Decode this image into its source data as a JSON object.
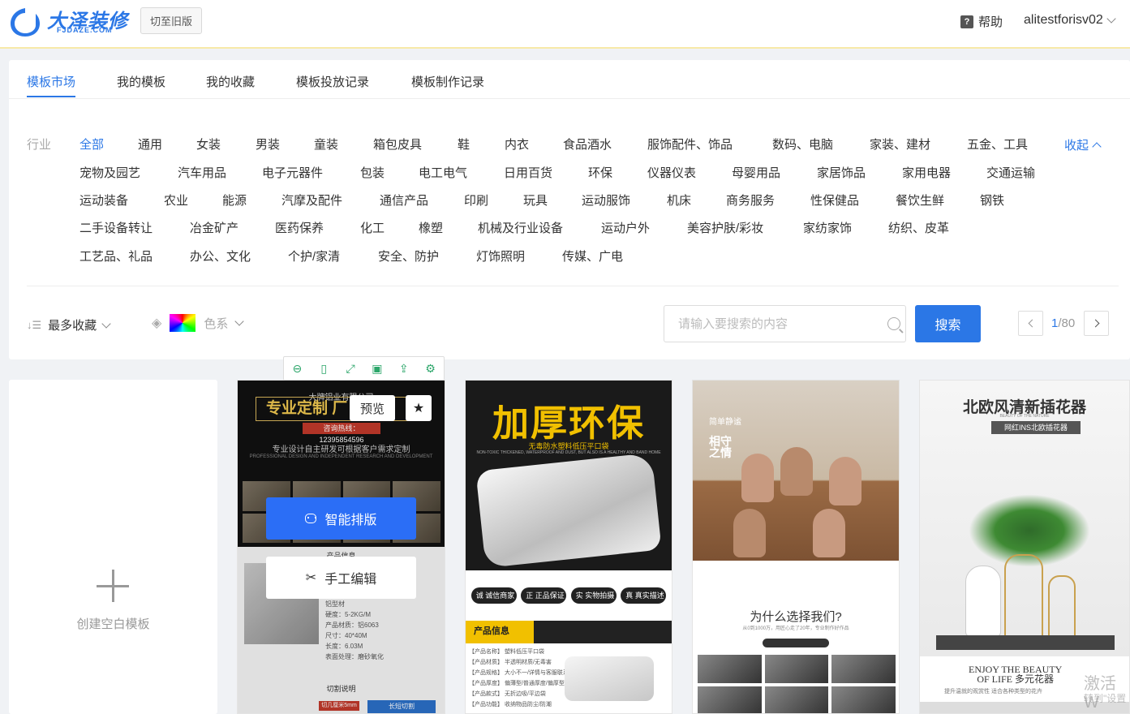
{
  "header": {
    "logo_text": "大泽装修",
    "logo_sub": "FJDAZE.COM",
    "old_version_label": "切至旧版",
    "help_label": "帮助",
    "username": "alitestforisv02"
  },
  "tabs": [
    "模板市场",
    "我的模板",
    "我的收藏",
    "模板投放记录",
    "模板制作记录"
  ],
  "filters": {
    "industry_label": "行业",
    "collapse_label": "收起",
    "categories": [
      "全部",
      "通用",
      "女装",
      "男装",
      "童装",
      "箱包皮具",
      "鞋",
      "内衣",
      "食品酒水",
      "服饰配件、饰品",
      "数码、电脑",
      "家装、建材",
      "五金、工具",
      "宠物及园艺",
      "汽车用品",
      "电子元器件",
      "包装",
      "电工电气",
      "日用百货",
      "环保",
      "仪器仪表",
      "母婴用品",
      "家居饰品",
      "家用电器",
      "交通运输",
      "运动装备",
      "农业",
      "能源",
      "汽摩及配件",
      "通信产品",
      "印刷",
      "玩具",
      "运动服饰",
      "机床",
      "商务服务",
      "性保健品",
      "餐饮生鲜",
      "钢铁",
      "二手设备转让",
      "冶金矿产",
      "医药保养",
      "化工",
      "橡塑",
      "机械及行业设备",
      "运动户外",
      "美容护肤/彩妆",
      "家纺家饰",
      "纺织、皮革",
      "工艺品、礼品",
      "办公、文化",
      "个护/家清",
      "安全、防护",
      "灯饰照明",
      "传媒、广电"
    ]
  },
  "toolbar": {
    "sort_label": "最多收藏",
    "color_label": "色系",
    "search_placeholder": "请输入要搜索的内容",
    "search_button": "搜索",
    "page_current": "1",
    "page_total": "/80"
  },
  "blank_card": {
    "label": "创建空白模板"
  },
  "hover": {
    "preview": "预览",
    "smart_layout": "智能排版",
    "manual_edit": "手工编辑"
  },
  "templates": {
    "t1": {
      "company": "大牌铝业有限公司",
      "slogan": "专业定制 厂",
      "hotline": "咨询热线：12395854596",
      "desc": "专业设计自主研发可根据客户需求定制",
      "desc_en": "PROFESSIONAL DESIGN AND INDEPENDENT RESEARCH AND DEVELOPMENT",
      "info_title": "产品信息",
      "spec": "铝型材\n硬度：5-2KG/M\n产品材质：铝6063\n尺寸：40*40M\n长度：6.03M\n表面处理：磨砂氧化",
      "cut_title": "切割说明",
      "red_tag": "切几厘米5mm",
      "cut_button": "长短切割"
    },
    "t2": {
      "headline": "加厚环保",
      "tagline": "无毒防水塑料低压平口袋",
      "tag_en": "NON-TOXIC THICKENED, WATERPROOF AND DUST, BUT ALSO IS A HEALTHY AND BAND HOME",
      "features": [
        "诚 诚信商家",
        "正 正品保证",
        "实 实物拍摄",
        "真 真实描述"
      ],
      "info_label": "产品信息",
      "rows": "【产品名称】 塑料低压平口袋\n【产品材质】 半透明材质/无毒害\n【产品规格】 大小不一/详情与客服联系\n【产品厚度】 偏薄型/普通厚度/偏厚型\n【产品款式】 无折边吸/平边袋\n【产品功能】 收纳物品防尘/防潮"
    },
    "t3": {
      "label1": "简单静谧",
      "label2": "相守之情",
      "why": "为什么选择我们?",
      "why_sub": "从0到1000万，用匠心走了20年，专业制作好作品"
    },
    "t4": {
      "title": "北欧风清新插花器",
      "title_en": "BEAUTY OF THE NATURE",
      "ins_tag": "网红INS北欧插花器",
      "enjoy": "ENJOY THE BEAUTY\nOF LIFE 多元花器",
      "enjoy_sub": "提升温就的观赏性  适合各种类型的花卉"
    }
  },
  "watermark": {
    "line1": "激活 W",
    "line2": "转到\"设置"
  },
  "colors": {
    "accent": "#2b77e6",
    "primary_button": "#2b6ef6",
    "tool_icon": "#2ca66a"
  }
}
